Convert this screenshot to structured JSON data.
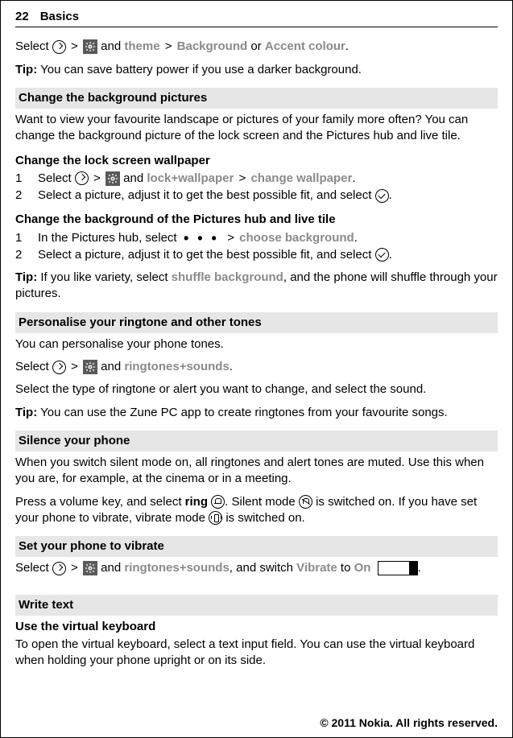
{
  "header": {
    "page_number": "22",
    "title": "Basics"
  },
  "intro": {
    "select": "Select",
    "and": "and",
    "theme": "theme",
    "background": "Background",
    "or": "or",
    "accent": "Accent colour",
    "tip_label": "Tip:",
    "tip_text": " You can save battery power if you use a darker background."
  },
  "bgpics": {
    "bar": "Change the background pictures",
    "desc": "Want to view your favourite landscape or pictures of your family more often? You can change the background picture of the lock screen and the Pictures hub and live tile."
  },
  "lockscreen": {
    "title": "Change the lock screen wallpaper",
    "step1_num": "1",
    "step1_select": "Select",
    "step1_and": "and",
    "step1_lockwp": "lock+wallpaper",
    "step1_changewp": "change wallpaper",
    "step2_num": "2",
    "step2_text": "Select a picture, adjust it to get the best possible fit, and select"
  },
  "pichub": {
    "title": "Change the background of the Pictures hub and live tile",
    "step1_num": "1",
    "step1_text_a": "In the Pictures hub, select",
    "step1_choose": "choose background",
    "step2_num": "2",
    "step2_text": "Select a picture, adjust it to get the best possible fit, and select",
    "tip_label": "Tip:",
    "tip_text_a": " If you like variety, select ",
    "tip_shuffle": "shuffle background",
    "tip_text_b": ", and the phone will shuffle through your pictures."
  },
  "ringtone": {
    "bar": "Personalise your ringtone and other tones",
    "desc": "You can personalise your phone tones.",
    "select": "Select",
    "and": "and",
    "rs": "ringtones+sounds",
    "line2": "Select the type of ringtone or alert you want to change, and select the sound.",
    "tip_label": "Tip:",
    "tip_text": " You can use the Zune PC app to create ringtones from your favourite songs."
  },
  "silence": {
    "bar": "Silence your phone",
    "desc": "When you switch silent mode on, all ringtones and alert tones are muted. Use this when you are, for example, at the cinema or in a meeting.",
    "press_a": "Press a volume key, and select ",
    "ring": "ring",
    "press_b": ". Silent mode",
    "press_c": "is switched on. If you have set your phone to vibrate, vibrate mode",
    "press_d": "is switched on."
  },
  "vibrate": {
    "bar": "Set your phone to vibrate",
    "select": "Select",
    "and": "and",
    "rs": "ringtones+sounds",
    "switch_a": ", and switch ",
    "vibrate": "Vibrate",
    "to": " to ",
    "on": "On"
  },
  "writetext": {
    "bar": "Write text",
    "title": "Use the virtual keyboard",
    "desc": "To open the virtual keyboard, select a text input field. You can use the virtual keyboard when holding your phone upright or on its side."
  },
  "footer": "© 2011 Nokia. All rights reserved.",
  "glyphs": {
    "gt": ">",
    "dot": ".",
    "dots": "• • •"
  }
}
